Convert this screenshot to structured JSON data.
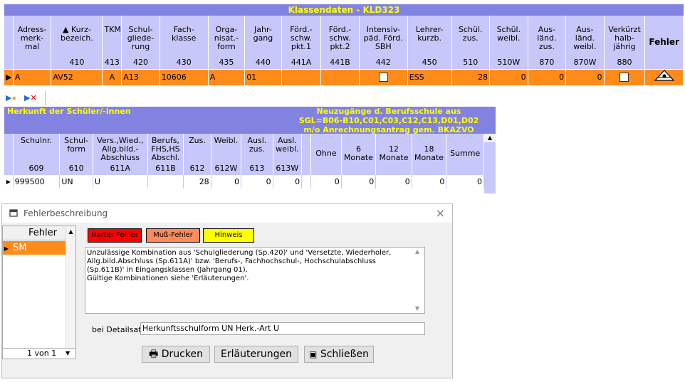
{
  "klassendaten": {
    "title": "Klassendaten - KLD323",
    "columns": [
      {
        "label": "Adress-merk-mal",
        "num": ""
      },
      {
        "label": "▲ Kurz-bezeich.",
        "num": "410"
      },
      {
        "label": "TKM",
        "num": "413"
      },
      {
        "label": "Schul-gliede-rung",
        "num": "420"
      },
      {
        "label": "Fach-klasse",
        "num": "430"
      },
      {
        "label": "Orga-nisat.-form",
        "num": "435"
      },
      {
        "label": "Jahr-gang",
        "num": "440"
      },
      {
        "label": "Förd.-schw. pkt.1",
        "num": "441A"
      },
      {
        "label": "Förd.-schw. pkt.2",
        "num": "441B"
      },
      {
        "label": "Intensiv-päd. Förd. SBH",
        "num": "442"
      },
      {
        "label": "Lehrer-kurzb.",
        "num": "450"
      },
      {
        "label": "Schül. zus.",
        "num": "510"
      },
      {
        "label": "Schül. weibl.",
        "num": "510W"
      },
      {
        "label": "Aus-länd. zus.",
        "num": "870"
      },
      {
        "label": "Aus-länd. weibl.",
        "num": "870W"
      },
      {
        "label": "Verkürzt halb-jährig",
        "num": "880"
      },
      {
        "label": "Fehler",
        "num": ""
      }
    ],
    "row": {
      "adressmerkmal": "A",
      "kurzbezeich": "AV52",
      "tkm": "A",
      "schulgliederung": "A13",
      "fachklasse": "10606",
      "organisationsform": "A",
      "jahrgang": "01",
      "foerd1": "",
      "foerd2": "",
      "lehrer": "ESS",
      "schueler_zus": "28",
      "schueler_weibl": "0",
      "auslaend_zus": "0",
      "auslaend_weibl": "0"
    }
  },
  "herkunft": {
    "title_left": "Herkunft der Schüler/-innen",
    "title_right_1": "Neuzugänge d. Berufsschule aus",
    "title_right_2": "SGL=B06-B10,C01,C03,C12,C13,D01,D02",
    "title_right_3": "m/o Anrechnungsantrag gem. BKAZVO",
    "columns": [
      {
        "label": "Schulnr.",
        "num": "609"
      },
      {
        "label": "Schul-form",
        "num": "610"
      },
      {
        "label": "Vers.,Wied., Allg.bild.-Abschluss",
        "num": "611A"
      },
      {
        "label": "Berufs, FHS,HS Abschl.",
        "num": "611B"
      },
      {
        "label": "Zus.",
        "num": "612"
      },
      {
        "label": "Weibl.",
        "num": "612W"
      },
      {
        "label": "Ausl. zus.",
        "num": "613"
      },
      {
        "label": "Ausl. weibl.",
        "num": "613W"
      },
      {
        "label": "Ohne",
        "num": ""
      },
      {
        "label": "6 Monate",
        "num": ""
      },
      {
        "label": "12 Monate",
        "num": ""
      },
      {
        "label": "18 Monate",
        "num": ""
      },
      {
        "label": "Summe",
        "num": ""
      }
    ],
    "row": {
      "schulnr": "999500",
      "schulform": "UN",
      "vers": "U",
      "berufs": "",
      "zus": "28",
      "weibl": "0",
      "ausl_zus": "0",
      "ausl_weibl": "0",
      "ohne": "0",
      "m6": "0",
      "m12": "0",
      "m18": "0",
      "summe": "0"
    }
  },
  "dialog": {
    "title": "Fehlerbeschreibung",
    "close": "×",
    "list_header": "Fehler",
    "selected_error": "SM",
    "nav": "1 von 1",
    "legend": {
      "hart": "Harter Fehler",
      "muss": "Muß-Fehler",
      "hinweis": "Hinweis"
    },
    "description": "Unzulässige Kombination aus 'Schulgliederung (Sp.420)' und 'Versetzte, Wiederholer, Allg.bild.Abschluss (Sp.611A)' bzw. 'Berufs-, Fachhochschul-, Hochschulabschluss (Sp.611B)' in Eingangsklassen (Jahrgang 01).\nGültige Kombinationen siehe 'Erläuterungen'.",
    "detail_label": "bei Detailsatz:",
    "detail_value": "Herkunftsschulform UN  Herk.-Art U",
    "buttons": {
      "drucken": "Drucken",
      "erlaeuterungen": "Erläuterungen",
      "schliessen": "Schließen"
    }
  },
  "colors": {
    "header": "#8282e0",
    "title_text": "#ffff00",
    "col_header": "#c7c7fa",
    "selected_row": "#ff8c1a"
  }
}
